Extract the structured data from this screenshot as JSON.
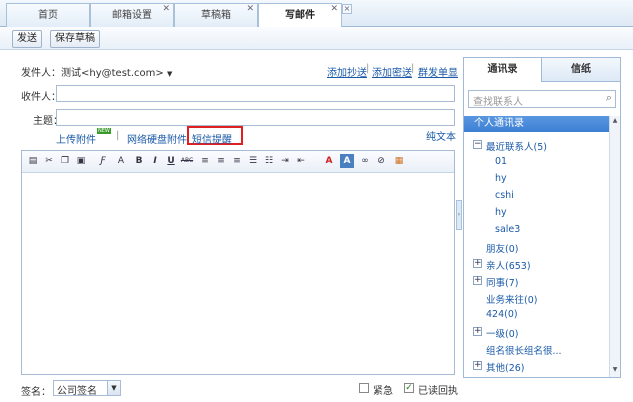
{
  "tabs": [
    {
      "label": "首页"
    },
    {
      "label": "邮箱设置"
    },
    {
      "label": "草稿箱"
    },
    {
      "label": "写邮件"
    }
  ],
  "toolbar": {
    "send": "发送",
    "save_draft": "保存草稿"
  },
  "form": {
    "sender_label": "发件人：",
    "sender_value": "测试<hy@test.com>",
    "add_cc": "添加抄送",
    "add_bcc": "添加密送",
    "separator": "|",
    "single_send": "群发单显",
    "recipient_label": "收件人：",
    "subject_label": "主题：",
    "upload": "上传附件",
    "network_disk": "网络硬盘附件",
    "sms_remind": "短信提醒",
    "plain_text": "纯文本",
    "new_badge": "NEW"
  },
  "footer": {
    "signature_label": "签名：",
    "signature_value": "公司签名",
    "urgent": "紧急",
    "read_receipt": "已读回执"
  },
  "contacts": {
    "tab_address": "通讯录",
    "tab_letter": "信纸",
    "search_placeholder": "查找联系人",
    "section_title": "个人通讯录",
    "groups": [
      {
        "label": "最近联系人(5)",
        "expand": "−",
        "children": [
          "01",
          "hy",
          "cshi",
          "hy",
          "sale3"
        ]
      },
      {
        "label": "朋友(0)",
        "expand": ""
      },
      {
        "label": "亲人(653)",
        "expand": "+"
      },
      {
        "label": "同事(7)",
        "expand": "+"
      },
      {
        "label": "业务来往(0)",
        "expand": ""
      },
      {
        "label": "424(0)",
        "expand": ""
      },
      {
        "label": "一级(0)",
        "expand": "+"
      },
      {
        "label": "组名很长组名很...",
        "expand": ""
      },
      {
        "label": "其他(26)",
        "expand": "+"
      }
    ]
  },
  "colors": {
    "accent": "#1a5aa8",
    "highlight": "#e02020",
    "section_bg": "#3b7fd4"
  }
}
